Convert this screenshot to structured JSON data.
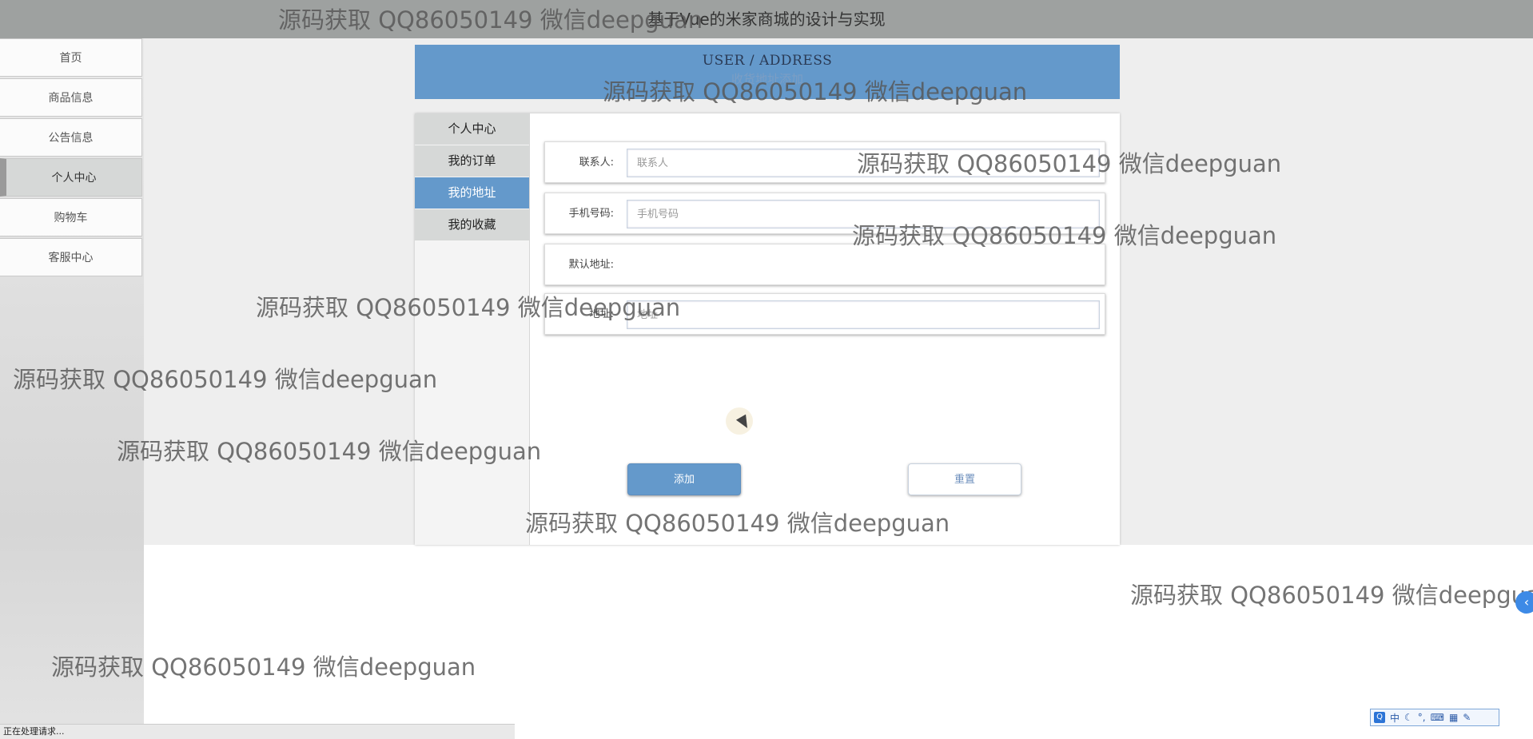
{
  "site": {
    "title": "基于Vue的米家商城的设计与实现"
  },
  "nav": {
    "items": [
      {
        "label": "首页"
      },
      {
        "label": "商品信息"
      },
      {
        "label": "公告信息"
      },
      {
        "label": "个人中心"
      },
      {
        "label": "购物车"
      },
      {
        "label": "客服中心"
      }
    ],
    "active": "个人中心"
  },
  "banner": {
    "en": "USER / ADDRESS",
    "cn": "收货地址添加"
  },
  "user_menu": {
    "items": [
      {
        "label": "个人中心"
      },
      {
        "label": "我的订单"
      },
      {
        "label": "我的地址"
      },
      {
        "label": "我的收藏"
      }
    ],
    "active": "我的地址"
  },
  "form": {
    "contact": {
      "label": "联系人:",
      "placeholder": "联系人"
    },
    "phone": {
      "label": "手机号码:",
      "placeholder": "手机号码"
    },
    "default": {
      "label": "默认地址:"
    },
    "address": {
      "label": "地址:",
      "placeholder": "地址"
    },
    "add_label": "添加",
    "reset_label": "重置"
  },
  "status_bar": {
    "text": "正在处理请求..."
  },
  "ime": {
    "mode": "中",
    "icons": [
      "moon-icon",
      "punctuation-icon",
      "keyboard-icon",
      "grid-icon",
      "tool-icon"
    ]
  },
  "watermark": {
    "text": "源码获取 QQ86050149 微信deepguan"
  }
}
